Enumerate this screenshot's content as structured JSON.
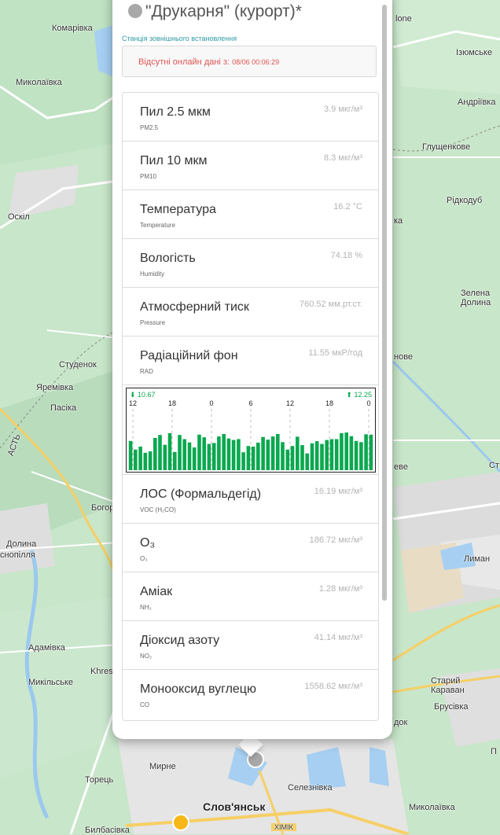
{
  "map": {
    "labels": {
      "komarivka": "Комарівка",
      "mykolaivka_left": "Миколаївка",
      "oskil": "Оскіл",
      "studenok": "Студенок",
      "yaremivka": "Яремівка",
      "pasika": "Пасіка",
      "bohor": "Богор",
      "dolyna": "Долина",
      "snopilla": "снопілля",
      "adamivka": "Адамівка",
      "khres": "Khres",
      "mykilske": "Микільське",
      "myrne": "Мирне",
      "torets": "Торець",
      "bylbasivka": "Билбасівка",
      "sloviansk": "Слов'янськ",
      "selezniivka": "Селезнівка",
      "mykolaivka_right": "Миколаївка",
      "khimik": "ХІМІК",
      "ione": "lone",
      "iziumske": "Ізюмське",
      "andriivka": "Андріївка",
      "hlushchenkove": "Глущенкове",
      "ridkodub": "Рідкодуб",
      "ka": "ка",
      "zelena": "Зелена",
      "dolyna_right": "Долина",
      "nove": "нове",
      "eve": "еве",
      "st": "Ст",
      "lyman": "Лиман",
      "staryi": "Старий",
      "karavan": "Караван",
      "brusivka": "Брусівка",
      "dok": "док",
      "p": "П",
      "ast": "АСТЬ"
    }
  },
  "popup": {
    "title": "\"Друкарня\" (курорт)*",
    "subtitle": "Станція зовнішнього встановлення",
    "alert_text": "Відсутні онлайн дані з: ",
    "alert_time": "08/06 00:06:29",
    "rows_top": [
      {
        "name": "Пил 2.5 мкм",
        "sub": "PM2.5",
        "value": "3.9 мкг/м³"
      },
      {
        "name": "Пил 10 мкм",
        "sub": "PM10",
        "value": "8.3 мкг/м³"
      },
      {
        "name": "Температура",
        "sub": "Temperature",
        "value": "16.2 °C"
      },
      {
        "name": "Вологість",
        "sub": "Humidity",
        "value": "74.18 %"
      },
      {
        "name": "Атмосферний тиск",
        "sub": "Pressure",
        "value": "760.52 мм.рт.ст."
      },
      {
        "name": "Радіаційний фон",
        "sub": "RAD",
        "value": "11.55 мкР/год"
      }
    ],
    "rows_bottom": [
      {
        "name": "ЛОС (Формальдегід)",
        "sub": "VOC (H₂CO)",
        "value": "16.19 мкг/м³"
      },
      {
        "name": "O₃",
        "sub": "O₃",
        "value": "186.72 мкг/м³"
      },
      {
        "name": "Аміак",
        "sub": "NH₃",
        "value": "1.28 мкг/м³"
      },
      {
        "name": "Діоксид азоту",
        "sub": "NO₂",
        "value": "41.14 мкг/м³"
      },
      {
        "name": "Монооксид вуглецю",
        "sub": "CO",
        "value": "1558.62 мкг/м³"
      }
    ]
  },
  "chart_data": {
    "type": "bar",
    "title": "",
    "min_label": "⬇ 10.67",
    "max_label": "⬆ 12.25",
    "tick_labels": [
      "12",
      "18",
      "0",
      "6",
      "12",
      "18",
      "0"
    ],
    "values": [
      11.44,
      11.15,
      11.25,
      11.04,
      11.09,
      11.54,
      11.64,
      11.31,
      11.7,
      11.07,
      11.64,
      11.5,
      11.39,
      11.22,
      11.65,
      11.56,
      11.34,
      11.37,
      11.59,
      11.67,
      11.52,
      11.47,
      11.5,
      11.06,
      11.27,
      11.25,
      11.38,
      11.57,
      11.48,
      11.59,
      11.67,
      11.4,
      11.15,
      11.27,
      11.58,
      11.3,
      11.02,
      11.36,
      11.43,
      11.34,
      11.47,
      11.5,
      11.5,
      11.7,
      11.72,
      11.6,
      11.44,
      11.4,
      11.66,
      11.65
    ],
    "ylim": [
      10.67,
      12.25
    ],
    "bar_color": "#0aa84f",
    "label_color": "#0aa84f"
  }
}
